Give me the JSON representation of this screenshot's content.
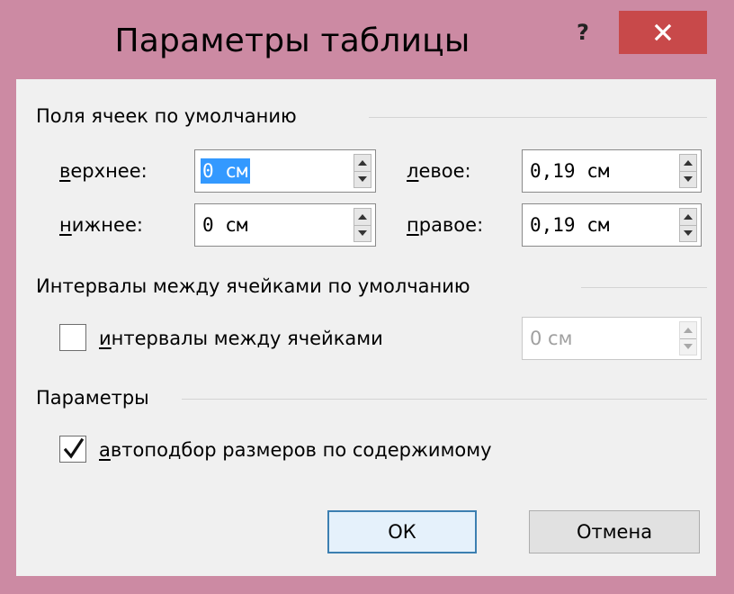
{
  "dialog": {
    "title": "Параметры таблицы",
    "help_label": "?",
    "colors": {
      "frame": "#cc8aa3",
      "close": "#c8494a",
      "client": "#f0f0f0",
      "selection": "#3399ff",
      "default_button_border": "#3c7fb1"
    }
  },
  "cell_margins": {
    "heading": "Поля ячеек по умолчанию",
    "top": {
      "label_underline": "в",
      "label_rest": "ерхнее:",
      "value": "0 см"
    },
    "bottom": {
      "label_underline": "н",
      "label_rest": "ижнее:",
      "value": "0 см"
    },
    "left": {
      "label_underline": "л",
      "label_rest": "евое:",
      "value": "0,19 см"
    },
    "right": {
      "label_underline": "п",
      "label_rest": "равое:",
      "value": "0,19 см"
    }
  },
  "cell_spacing": {
    "heading": "Интервалы между ячейками по умолчанию",
    "checkbox_label_underline": "и",
    "checkbox_label_rest": "нтервалы между ячейками",
    "checked": false,
    "value": "0 см",
    "enabled": false
  },
  "options": {
    "heading": "Параметры",
    "autofit_label_underline": "а",
    "autofit_label_rest": "втоподбор размеров по содержимому",
    "autofit_checked": true
  },
  "buttons": {
    "ok": "ОК",
    "cancel": "Отмена"
  }
}
